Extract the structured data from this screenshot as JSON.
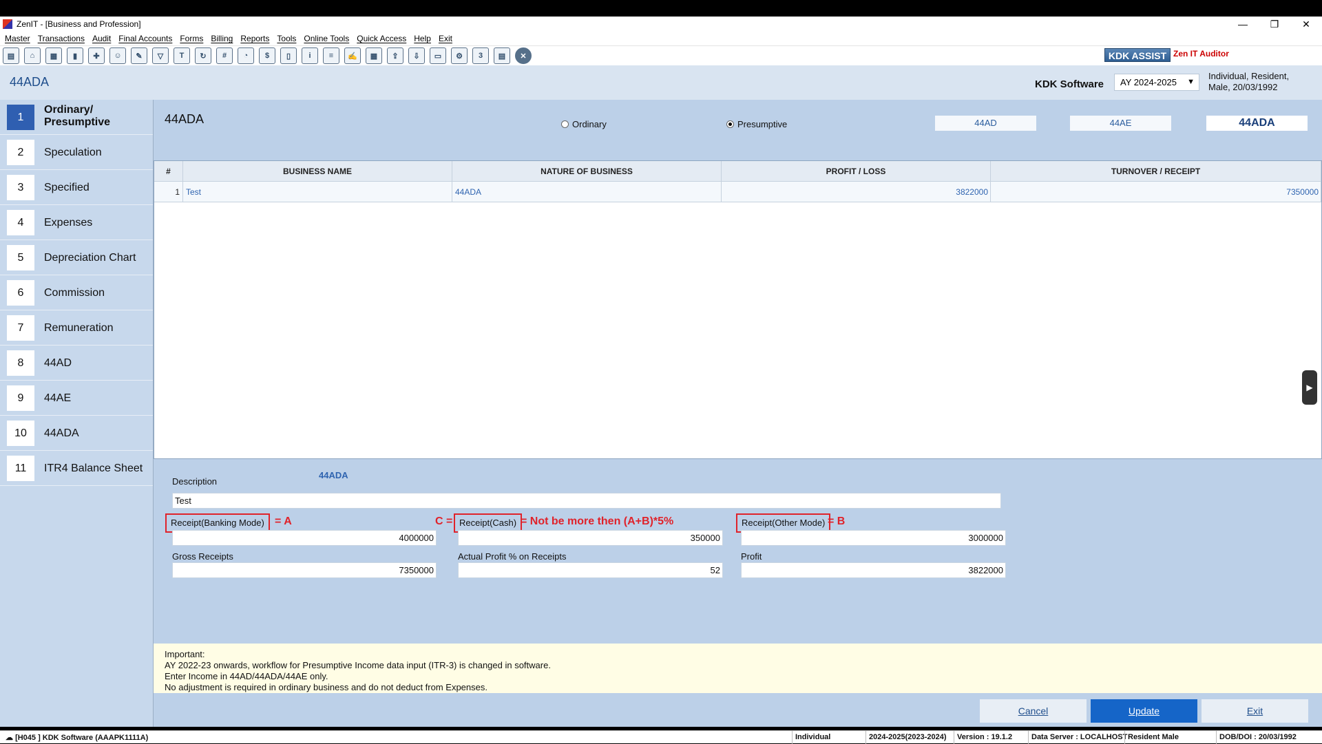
{
  "window": {
    "title": "ZenIT - [Business and Profession]",
    "controls": {
      "minimize": "—",
      "restore": "❐",
      "close": "✕"
    }
  },
  "menu": [
    "Master",
    "Transactions",
    "Audit",
    "Final Accounts",
    "Forms",
    "Billing",
    "Reports",
    "Tools",
    "Online Tools",
    "Quick Access",
    "Help",
    "Exit"
  ],
  "toolbar": {
    "icons": [
      "open-file-icon",
      "home-icon",
      "building-icon",
      "bar-chart-icon",
      "gift-icon",
      "users-icon",
      "tag-icon",
      "filter-icon",
      "tax-icon",
      "refresh-icon",
      "calculator-icon",
      "pie-icon",
      "pay-icon",
      "book-icon",
      "info-icon",
      "document-icon",
      "edit-document-icon",
      "calendar-icon",
      "export-icon",
      "import-icon",
      "id-card-icon",
      "network-icon",
      "3cd-icon",
      "report-icon",
      "close-icon"
    ],
    "kdk_assist": "KDK ASSIST",
    "zen_auditor": "Zen IT Auditor"
  },
  "header": {
    "page_title": "44ADA",
    "company": "KDK Software",
    "assessment_year": "AY 2024-2025",
    "assessee_line1": "Individual, Resident,",
    "assessee_line2": "Male, 20/03/1992"
  },
  "sidebar": {
    "items": [
      {
        "num": "1",
        "label": "Ordinary/ Presumptive",
        "active": true
      },
      {
        "num": "2",
        "label": "Speculation"
      },
      {
        "num": "3",
        "label": "Specified"
      },
      {
        "num": "4",
        "label": "Expenses"
      },
      {
        "num": "5",
        "label": "Depreciation Chart"
      },
      {
        "num": "6",
        "label": "Commission"
      },
      {
        "num": "7",
        "label": "Remuneration"
      },
      {
        "num": "8",
        "label": "44AD"
      },
      {
        "num": "9",
        "label": "44AE"
      },
      {
        "num": "10",
        "label": "44ADA"
      },
      {
        "num": "11",
        "label": "ITR4 Balance Sheet"
      }
    ]
  },
  "main": {
    "section_title": "44ADA",
    "radio_ordinary": "Ordinary",
    "radio_presumptive": "Presumptive",
    "tabs": [
      "44AD",
      "44AE",
      "44ADA"
    ],
    "grid": {
      "headers": [
        "#",
        "BUSINESS NAME",
        "NATURE OF BUSINESS",
        "PROFIT / LOSS",
        "TURNOVER / RECEIPT"
      ],
      "rows": [
        [
          "1",
          "Test",
          "44ADA",
          "3822000",
          "7350000"
        ]
      ]
    },
    "scroll_arrow": "▶"
  },
  "form": {
    "description_label": "Description",
    "description_link": "44ADA",
    "description_value": "Test",
    "receipt_banking_label": "Receipt(Banking Mode)",
    "receipt_banking_value": "4000000",
    "receipt_cash_label": "Receipt(Cash)",
    "receipt_cash_value": "350000",
    "receipt_other_label": "Receipt(Other Mode)",
    "receipt_other_value": "3000000",
    "gross_receipts_label": "Gross Receipts",
    "gross_receipts_value": "7350000",
    "actual_profit_label": "Actual Profit % on Receipts",
    "actual_profit_value": "52",
    "profit_label": "Profit",
    "profit_value": "3822000",
    "annot_a": "= A",
    "annot_c_prefix": "C =",
    "annot_c_suffix": "= Not be more then (A+B)*5%",
    "annot_b": "= B"
  },
  "notice": {
    "line1": "Important:",
    "line2": "AY 2022-23 onwards, workflow for Presumptive Income data input (ITR-3) is changed in software.",
    "line3": "Enter Income in 44AD/44ADA/44AE only.",
    "line4": "No adjustment is required in ordinary business and do not deduct from Expenses."
  },
  "buttons": {
    "cancel": "Cancel",
    "update": "Update",
    "exit": "Exit"
  },
  "statusbar": {
    "left": "[H045 ] KDK Software (AAAPK1111A)",
    "type": "Individual",
    "year": "2024-2025(2023-2024)",
    "version": "Version : 19.1.2",
    "server": "Data Server : LOCALHOST",
    "residency": "Resident Male",
    "dob": "DOB/DOI : 20/03/1992"
  },
  "colors": {
    "accent": "#1565c8",
    "annotation": "#e0222a",
    "sidebar_bg": "#c7d8ec",
    "main_bg": "#bcd0e8"
  }
}
